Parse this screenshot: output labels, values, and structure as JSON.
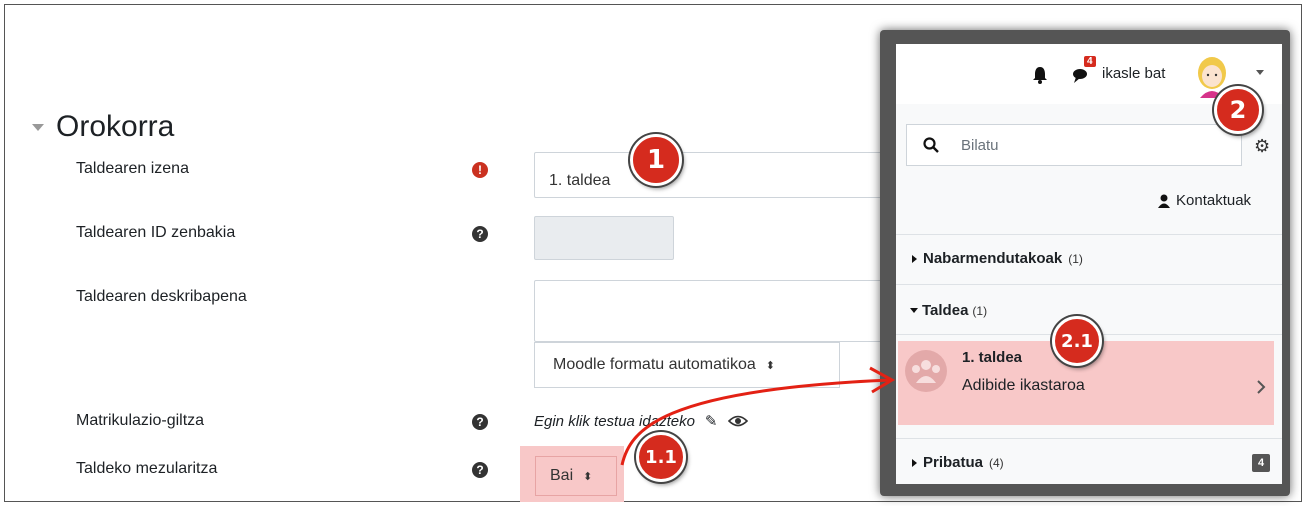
{
  "form": {
    "section_title": "Orokorra",
    "fields": [
      {
        "label": "Taldearen izena",
        "help": "!",
        "value": "1. taldea"
      },
      {
        "label": "Taldearen ID zenbakia",
        "help": "?",
        "value": ""
      },
      {
        "label": "Taldearen deskribapena",
        "format_select": "Moodle formatu automatikoa"
      },
      {
        "label": "Matrikulazio-giltza",
        "help": "?",
        "value": "Egin klik testua idazteko"
      },
      {
        "label": "Taldeko mezularitza",
        "help": "?",
        "value": "Bai"
      }
    ]
  },
  "navbar": {
    "message_badge": "4",
    "user_name": "ikasle bat"
  },
  "drawer": {
    "search_placeholder": "Bilatu",
    "contacts_label": "Kontaktuak",
    "sections": [
      {
        "title": "Nabarmendutakoak",
        "count": "(1)"
      },
      {
        "title": "Taldea",
        "count": "(1)"
      },
      {
        "title": "Pribatua",
        "count": "(4)",
        "badge": "4"
      }
    ],
    "group_item": {
      "name": "1. taldea",
      "course": "Adibide ikastaroa"
    }
  },
  "callouts": {
    "c1": "1",
    "c11": "1.1",
    "c2": "2",
    "c21": "2.1"
  },
  "colors": {
    "callout": "#d52b1e",
    "highlight": "#f8c8c8",
    "required": "#ca3120"
  }
}
